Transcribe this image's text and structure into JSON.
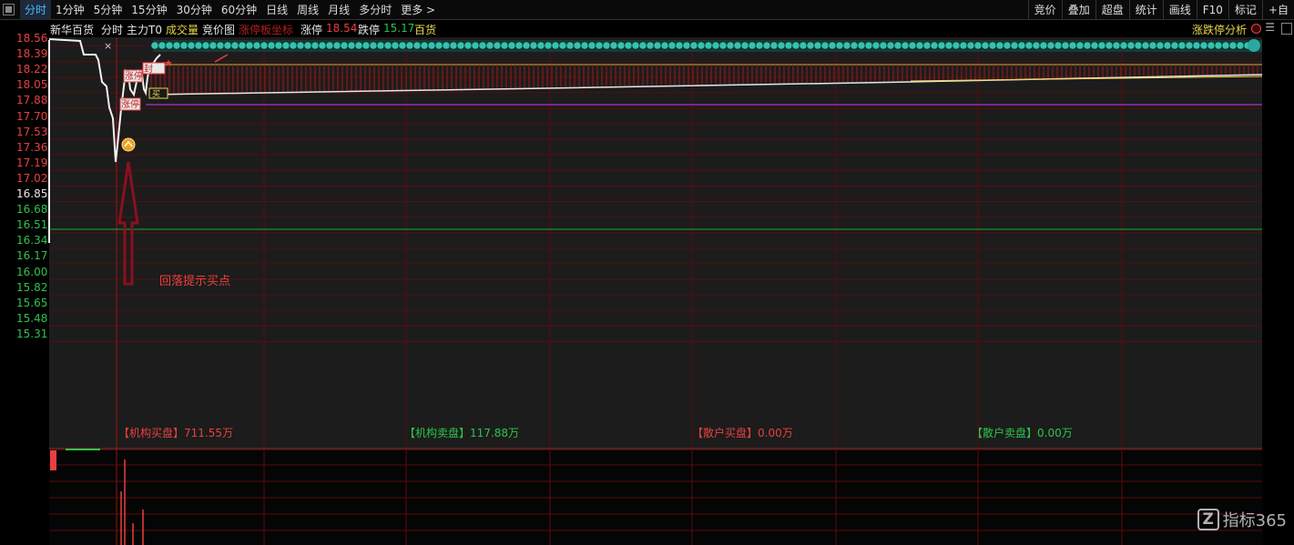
{
  "toolbar": {
    "period_tabs": [
      "分时",
      "1分钟",
      "5分钟",
      "15分钟",
      "30分钟",
      "60分钟",
      "日线",
      "周线",
      "月线",
      "多分时",
      "更多 >"
    ],
    "right_tools": [
      "竞价",
      "叠加",
      "超盘",
      "统计",
      "画线",
      "F10",
      "标记",
      "+自"
    ]
  },
  "info": {
    "stock_name": "新华百货",
    "view": "分时",
    "indicator": "主力T0",
    "volume": "成交量",
    "auction": "竞价图",
    "limit_coord": "涨停板坐标",
    "limit_up_label": "涨停",
    "limit_up_value": "18.54",
    "limit_down_label": "跌停",
    "limit_down_value": "15.17",
    "sector": "百货",
    "analysis": "涨跌停分析",
    "menu_glyph": "☰"
  },
  "chart": {
    "y_labels": [
      "18.56",
      "18.39",
      "18.22",
      "18.05",
      "17.88",
      "17.70",
      "17.53",
      "17.36",
      "17.19",
      "17.02",
      "16.85",
      "16.68",
      "16.51",
      "16.34",
      "16.17",
      "16.00",
      "15.82",
      "15.65",
      "15.48",
      "15.31"
    ],
    "red_labels": [
      "18.56",
      "18.39",
      "18.22",
      "18.05",
      "17.88",
      "17.70",
      "17.53",
      "17.36",
      "17.19",
      "17.02"
    ],
    "white_labels": [
      "16.85"
    ],
    "green_labels": [
      "16.68",
      "16.51",
      "16.34",
      "16.17",
      "16.00",
      "15.82",
      "15.65",
      "15.48",
      "15.31"
    ],
    "annotation": "回落提示买点",
    "badges": [
      "涨停",
      "涨停",
      "涨停",
      "买",
      "封"
    ],
    "close_glyph": "×"
  },
  "flows": [
    {
      "label": "【机构买盘】",
      "value": "711.55万",
      "color": "#e84040"
    },
    {
      "label": "【机构卖盘】",
      "value": "117.88万",
      "color": "#2cc44a"
    },
    {
      "label": "【散户买盘】",
      "value": "0.00万",
      "color": "#e84040"
    },
    {
      "label": "【散户卖盘】",
      "value": "0.00万",
      "color": "#2cc44a"
    }
  ],
  "watermark": {
    "logo": "Z",
    "text": "指标365"
  },
  "colors": {
    "up": "#e84040",
    "down": "#2cc44a",
    "grid": "#7a1010",
    "accent": "#4ab7ff"
  }
}
